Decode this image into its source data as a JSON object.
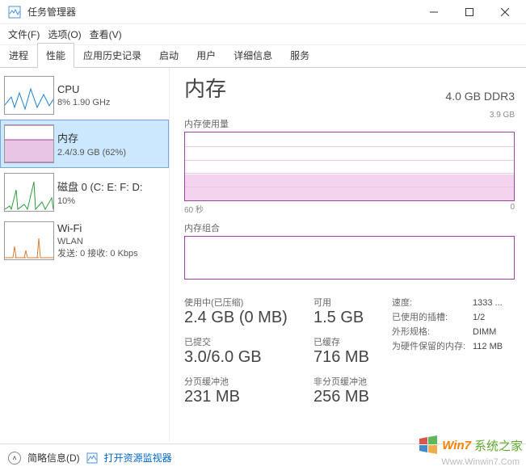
{
  "window": {
    "title": "任务管理器"
  },
  "menu": {
    "file": "文件(F)",
    "options": "选项(O)",
    "view": "查看(V)"
  },
  "tabs": [
    "进程",
    "性能",
    "应用历史记录",
    "启动",
    "用户",
    "详细信息",
    "服务"
  ],
  "active_tab_index": 1,
  "sidebar": [
    {
      "title": "CPU",
      "sub": "8% 1.90 GHz"
    },
    {
      "title": "内存",
      "sub": "2.4/3.9 GB (62%)"
    },
    {
      "title": "磁盘 0 (C: E: F: D:",
      "sub": "10%"
    },
    {
      "title": "Wi-Fi",
      "sub": "WLAN",
      "sub2": "发送: 0 接收: 0 Kbps"
    }
  ],
  "main": {
    "title": "内存",
    "right": "4.0 GB DDR3",
    "usage_label": "内存使用量",
    "usage_max": "3.9 GB",
    "axis_left": "60 秒",
    "axis_right": "0",
    "comp_label": "内存组合",
    "stats_left": [
      {
        "label": "使用中(已压缩)",
        "value": "2.4 GB (0 MB)"
      },
      {
        "label": "已提交",
        "value": "3.0/6.0 GB"
      },
      {
        "label": "分页缓冲池",
        "value": "231 MB"
      }
    ],
    "stats_mid": [
      {
        "label": "可用",
        "value": "1.5 GB"
      },
      {
        "label": "已缓存",
        "value": "716 MB"
      },
      {
        "label": "非分页缓冲池",
        "value": "256 MB"
      }
    ],
    "kv": [
      {
        "k": "速度:",
        "v": "1333 ..."
      },
      {
        "k": "已使用的插槽:",
        "v": "1/2"
      },
      {
        "k": "外形规格:",
        "v": "DIMM"
      },
      {
        "k": "为硬件保留的内存:",
        "v": "112 MB"
      }
    ]
  },
  "status": {
    "brief": "简略信息(D)",
    "link": "打开资源监视器"
  },
  "watermark": {
    "brand1": "Win7",
    "brand2": "系统之家",
    "url": "Www.Winwin7.Com"
  },
  "chart_data": {
    "memory_usage": {
      "type": "area",
      "xlabel": "60 秒",
      "ylabel": "",
      "ylim": [
        0,
        3.9
      ],
      "value_current_gb": 2.4,
      "fill_fraction": 0.62
    },
    "memory_composition": {
      "type": "bar",
      "total_gb": 3.9,
      "segments": []
    }
  }
}
